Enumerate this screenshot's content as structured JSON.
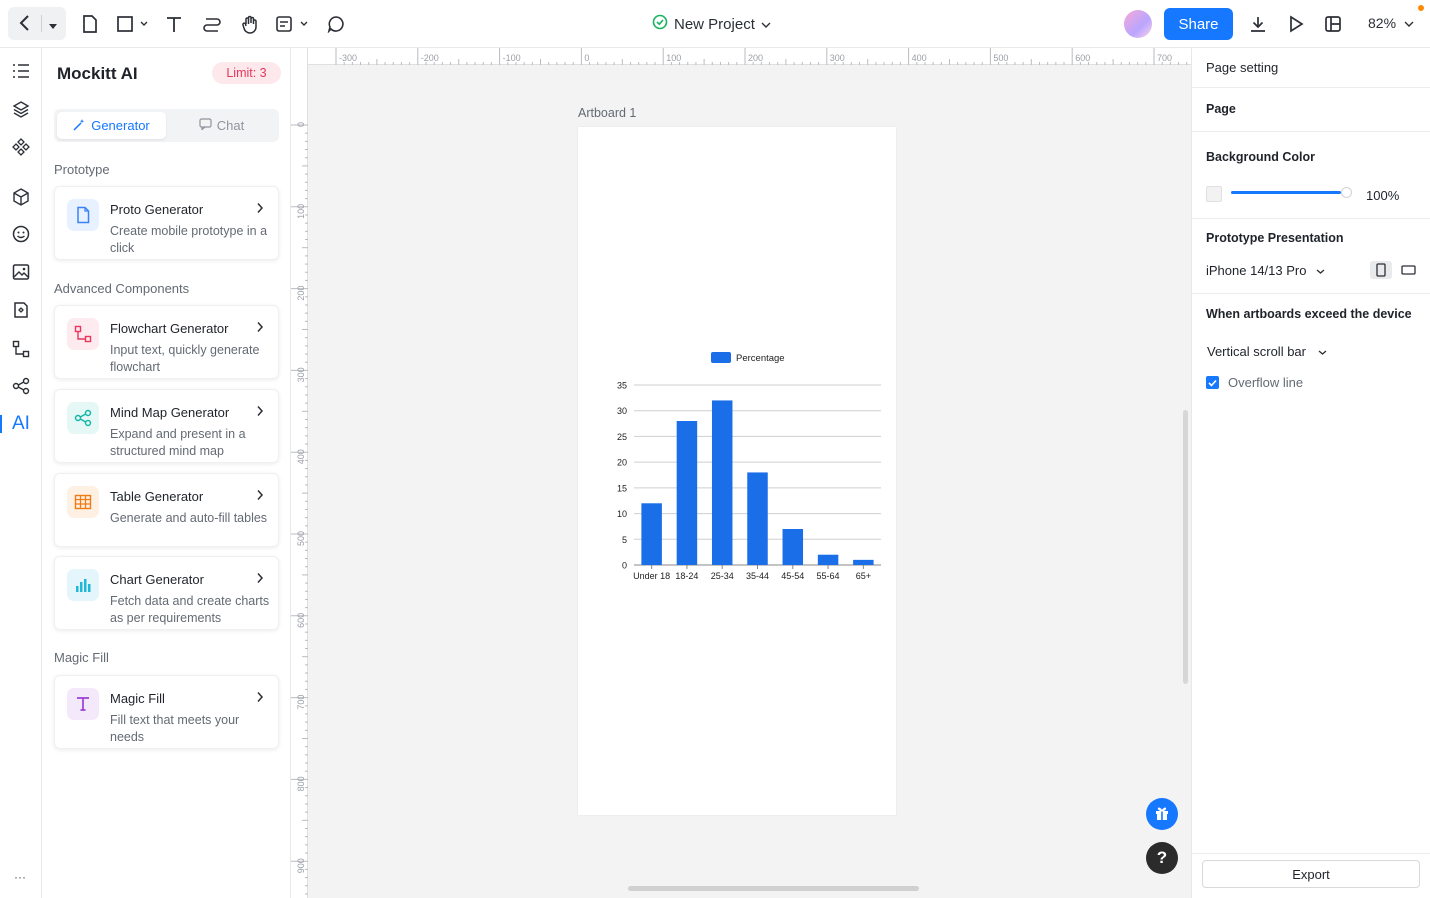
{
  "topbar": {
    "project_title": "New Project",
    "share_label": "Share",
    "zoom": "82%"
  },
  "ai_panel": {
    "title": "Mockitt AI",
    "limit": "Limit: 3",
    "tabs": {
      "generator": "Generator",
      "chat": "Chat"
    },
    "sections": {
      "prototype": "Prototype",
      "advanced": "Advanced Components",
      "magic": "Magic Fill"
    },
    "cards": [
      {
        "title": "Proto Generator",
        "desc": "Create mobile prototype in a click",
        "icon": "document-icon",
        "color": "#3b82f6"
      },
      {
        "title": "Flowchart Generator",
        "desc": "Input text, quickly generate flowchart",
        "icon": "flowchart-icon",
        "color": "#e8365d"
      },
      {
        "title": "Mind Map Generator",
        "desc": "Expand and present in a structured mind map",
        "icon": "mindmap-icon",
        "color": "#13b5a6"
      },
      {
        "title": "Table Generator",
        "desc": "Generate and auto-fill tables",
        "icon": "table-icon",
        "color": "#f07b15"
      },
      {
        "title": "Chart Generator",
        "desc": "Fetch data and create charts as per requirements",
        "icon": "bar-chart-icon",
        "color": "#1fb8d6"
      },
      {
        "title": "Magic Fill",
        "desc": "Fill text that meets your needs",
        "icon": "text-icon",
        "color": "#9b3fd6"
      }
    ]
  },
  "rail": {
    "ai_label": "AI"
  },
  "canvas": {
    "artboard_label": "Artboard 1",
    "ruler_top": [
      "-300",
      "-200",
      "-100",
      "0",
      "100",
      "200",
      "300",
      "400",
      "500",
      "600",
      "700"
    ],
    "ruler_left": [
      "0",
      "100",
      "200",
      "300",
      "400",
      "500",
      "600",
      "700",
      "800",
      "900"
    ]
  },
  "chart_data": {
    "type": "bar",
    "categories": [
      "Under 18",
      "18-24",
      "25-34",
      "35-44",
      "45-54",
      "55-64",
      "65+"
    ],
    "series": [
      {
        "name": "Percentage",
        "values": [
          12,
          28,
          32,
          18,
          7,
          2,
          1
        ]
      }
    ],
    "ylim": [
      0,
      35
    ],
    "yticks": [
      0,
      5,
      10,
      15,
      20,
      25,
      30,
      35
    ],
    "legend": "top",
    "grid": true,
    "color": "#1a6fe8"
  },
  "right_panel": {
    "page_setting": "Page setting",
    "page": "Page",
    "background_color": "Background Color",
    "opacity": "100%",
    "prototype_presentation": "Prototype Presentation",
    "device": "iPhone 14/13 Pro",
    "exceed_label": "When artboards exceed the device",
    "scroll_mode": "Vertical scroll bar",
    "overflow_line": "Overflow line",
    "export": "Export"
  }
}
